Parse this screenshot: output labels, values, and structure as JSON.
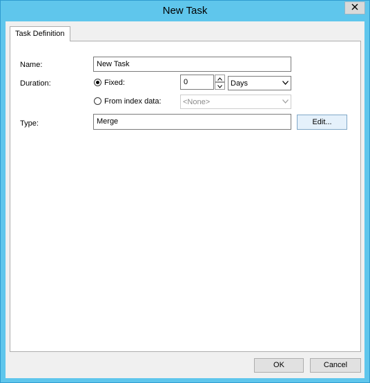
{
  "window": {
    "title": "New Task"
  },
  "tabs": [
    {
      "label": "Task Definition",
      "active": true
    }
  ],
  "form": {
    "name_label": "Name:",
    "name_value": "New Task",
    "duration_label": "Duration:",
    "fixed_label": "Fixed:",
    "fixed_selected": true,
    "fixed_value": "0",
    "unit_value": "Days",
    "from_index_label": "From index data:",
    "from_index_selected": false,
    "from_index_value": "<None>",
    "type_label": "Type:",
    "type_value": "Merge",
    "edit_label": "Edit..."
  },
  "footer": {
    "ok_label": "OK",
    "cancel_label": "Cancel"
  },
  "icons": {
    "close": "close-icon",
    "up": "chevron-up-icon",
    "down": "chevron-down-icon"
  }
}
